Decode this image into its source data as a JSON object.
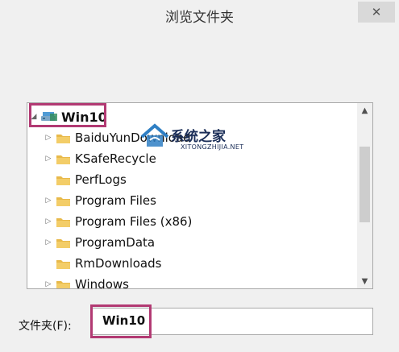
{
  "window": {
    "title": "浏览文件夹",
    "close_glyph": "✕"
  },
  "tree": {
    "root": {
      "label": "Win10",
      "expander": "◢",
      "icon": "drive-icon"
    },
    "items": [
      {
        "label": "BaiduYunDownload",
        "expander": "▷",
        "icon": "folder-icon"
      },
      {
        "label": "KSafeRecycle",
        "expander": "▷",
        "icon": "folder-icon"
      },
      {
        "label": "PerfLogs",
        "expander": "",
        "icon": "folder-icon"
      },
      {
        "label": "Program Files",
        "expander": "▷",
        "icon": "folder-icon"
      },
      {
        "label": "Program Files (x86)",
        "expander": "▷",
        "icon": "folder-icon"
      },
      {
        "label": "ProgramData",
        "expander": "▷",
        "icon": "folder-icon"
      },
      {
        "label": "RmDownloads",
        "expander": "",
        "icon": "folder-icon"
      },
      {
        "label": "Windows",
        "expander": "▷",
        "icon": "folder-icon"
      }
    ],
    "scroll_up": "▲",
    "scroll_down": "▼"
  },
  "watermark": {
    "text": "系统之家",
    "sub": "XITONGZHIJIA.NET"
  },
  "folder_field": {
    "label": "文件夹(F):",
    "value": "Win10"
  },
  "colors": {
    "highlight": "#b23a73",
    "folder": "#e8b94a"
  }
}
